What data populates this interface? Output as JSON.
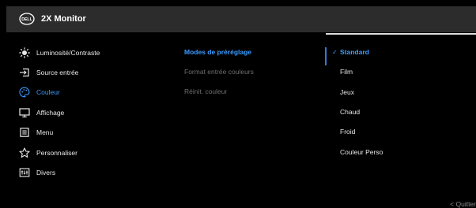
{
  "header": {
    "brand": "DELL",
    "title": "2X Monitor"
  },
  "menu": {
    "items": [
      {
        "icon": "brightness-icon",
        "label": "Luminosité/Contraste",
        "active": false
      },
      {
        "icon": "input-source-icon",
        "label": "Source entrée",
        "active": false
      },
      {
        "icon": "color-palette-icon",
        "label": "Couleur",
        "active": true
      },
      {
        "icon": "display-icon",
        "label": "Affichage",
        "active": false
      },
      {
        "icon": "menu-icon",
        "label": "Menu",
        "active": false
      },
      {
        "icon": "star-icon",
        "label": "Personnaliser",
        "active": false
      },
      {
        "icon": "others-icon",
        "label": "Divers",
        "active": false
      }
    ]
  },
  "submenu": {
    "items": [
      {
        "label": "Modes de préréglage",
        "state": "active"
      },
      {
        "label": "Format entrée couleurs",
        "state": "disabled"
      },
      {
        "label": "Réinit. couleur",
        "state": "disabled"
      }
    ]
  },
  "options": {
    "items": [
      {
        "label": "Standard",
        "selected": true
      },
      {
        "label": "Film",
        "selected": false
      },
      {
        "label": "Jeux",
        "selected": false
      },
      {
        "label": "Chaud",
        "selected": false
      },
      {
        "label": "Froid",
        "selected": false
      },
      {
        "label": "Couleur Perso",
        "selected": false
      }
    ]
  },
  "footer": {
    "quit_label": "< Quitter"
  },
  "colors": {
    "accent": "#3b9cff",
    "selection_bar": "#2f7dd9",
    "header_bg": "#2c2c2c",
    "disabled_text": "#6e6e6e"
  }
}
